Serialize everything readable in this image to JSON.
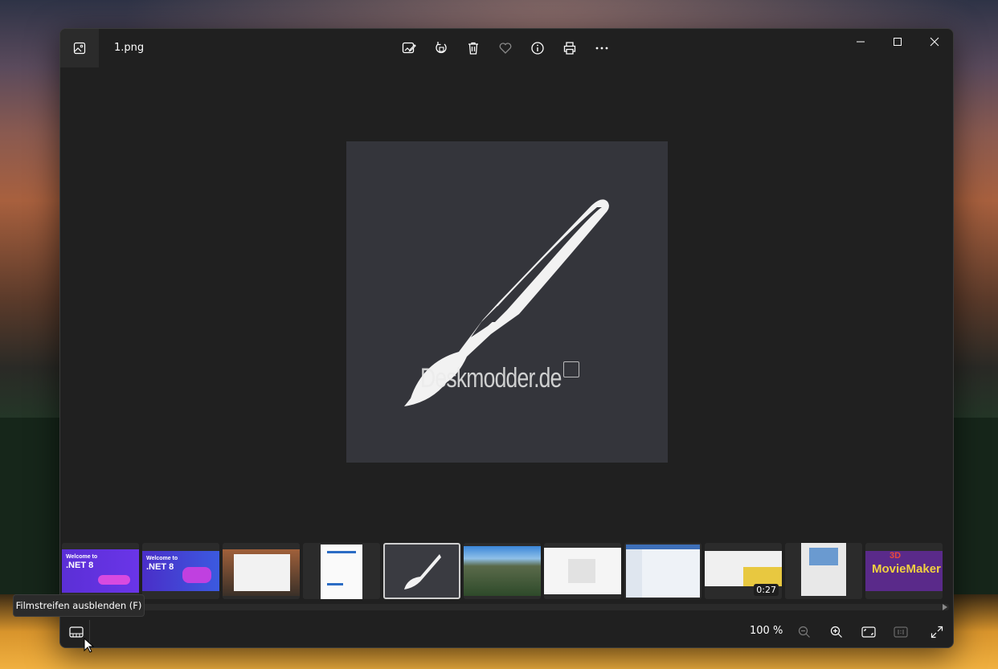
{
  "window": {
    "filename": "1.png"
  },
  "toolbar": {
    "icons": [
      "edit-image-icon",
      "rotate-icon",
      "delete-icon",
      "favorite-icon",
      "info-icon",
      "print-icon",
      "more-icon"
    ]
  },
  "window_controls": [
    "minimize-icon",
    "maximize-icon",
    "close-icon"
  ],
  "image": {
    "watermark_text": "Deskmodder.de"
  },
  "filmstrip": {
    "items": [
      {
        "title": "Welcome to",
        "subtitle": ".NET 8"
      },
      {
        "title": "Welcome to",
        "subtitle": ".NET 8"
      },
      {
        "title": "",
        "subtitle": ""
      },
      {
        "title": "",
        "subtitle": ""
      },
      {
        "title": "",
        "subtitle": "",
        "selected": true
      },
      {
        "title": "",
        "subtitle": ""
      },
      {
        "title": "",
        "subtitle": ""
      },
      {
        "title": "",
        "subtitle": ""
      },
      {
        "title": "",
        "subtitle": "",
        "duration": "0:27"
      },
      {
        "title": "",
        "subtitle": ""
      },
      {
        "title": "3D",
        "subtitle": "MovieMaker"
      }
    ]
  },
  "statusbar": {
    "zoom_level": "100 %"
  },
  "tooltip": {
    "text": "Filmstreifen ausblenden (F)"
  },
  "colors": {
    "window_bg": "#202020",
    "image_bg": "#34353b",
    "accent_dotnet": "#5b2fd6"
  }
}
